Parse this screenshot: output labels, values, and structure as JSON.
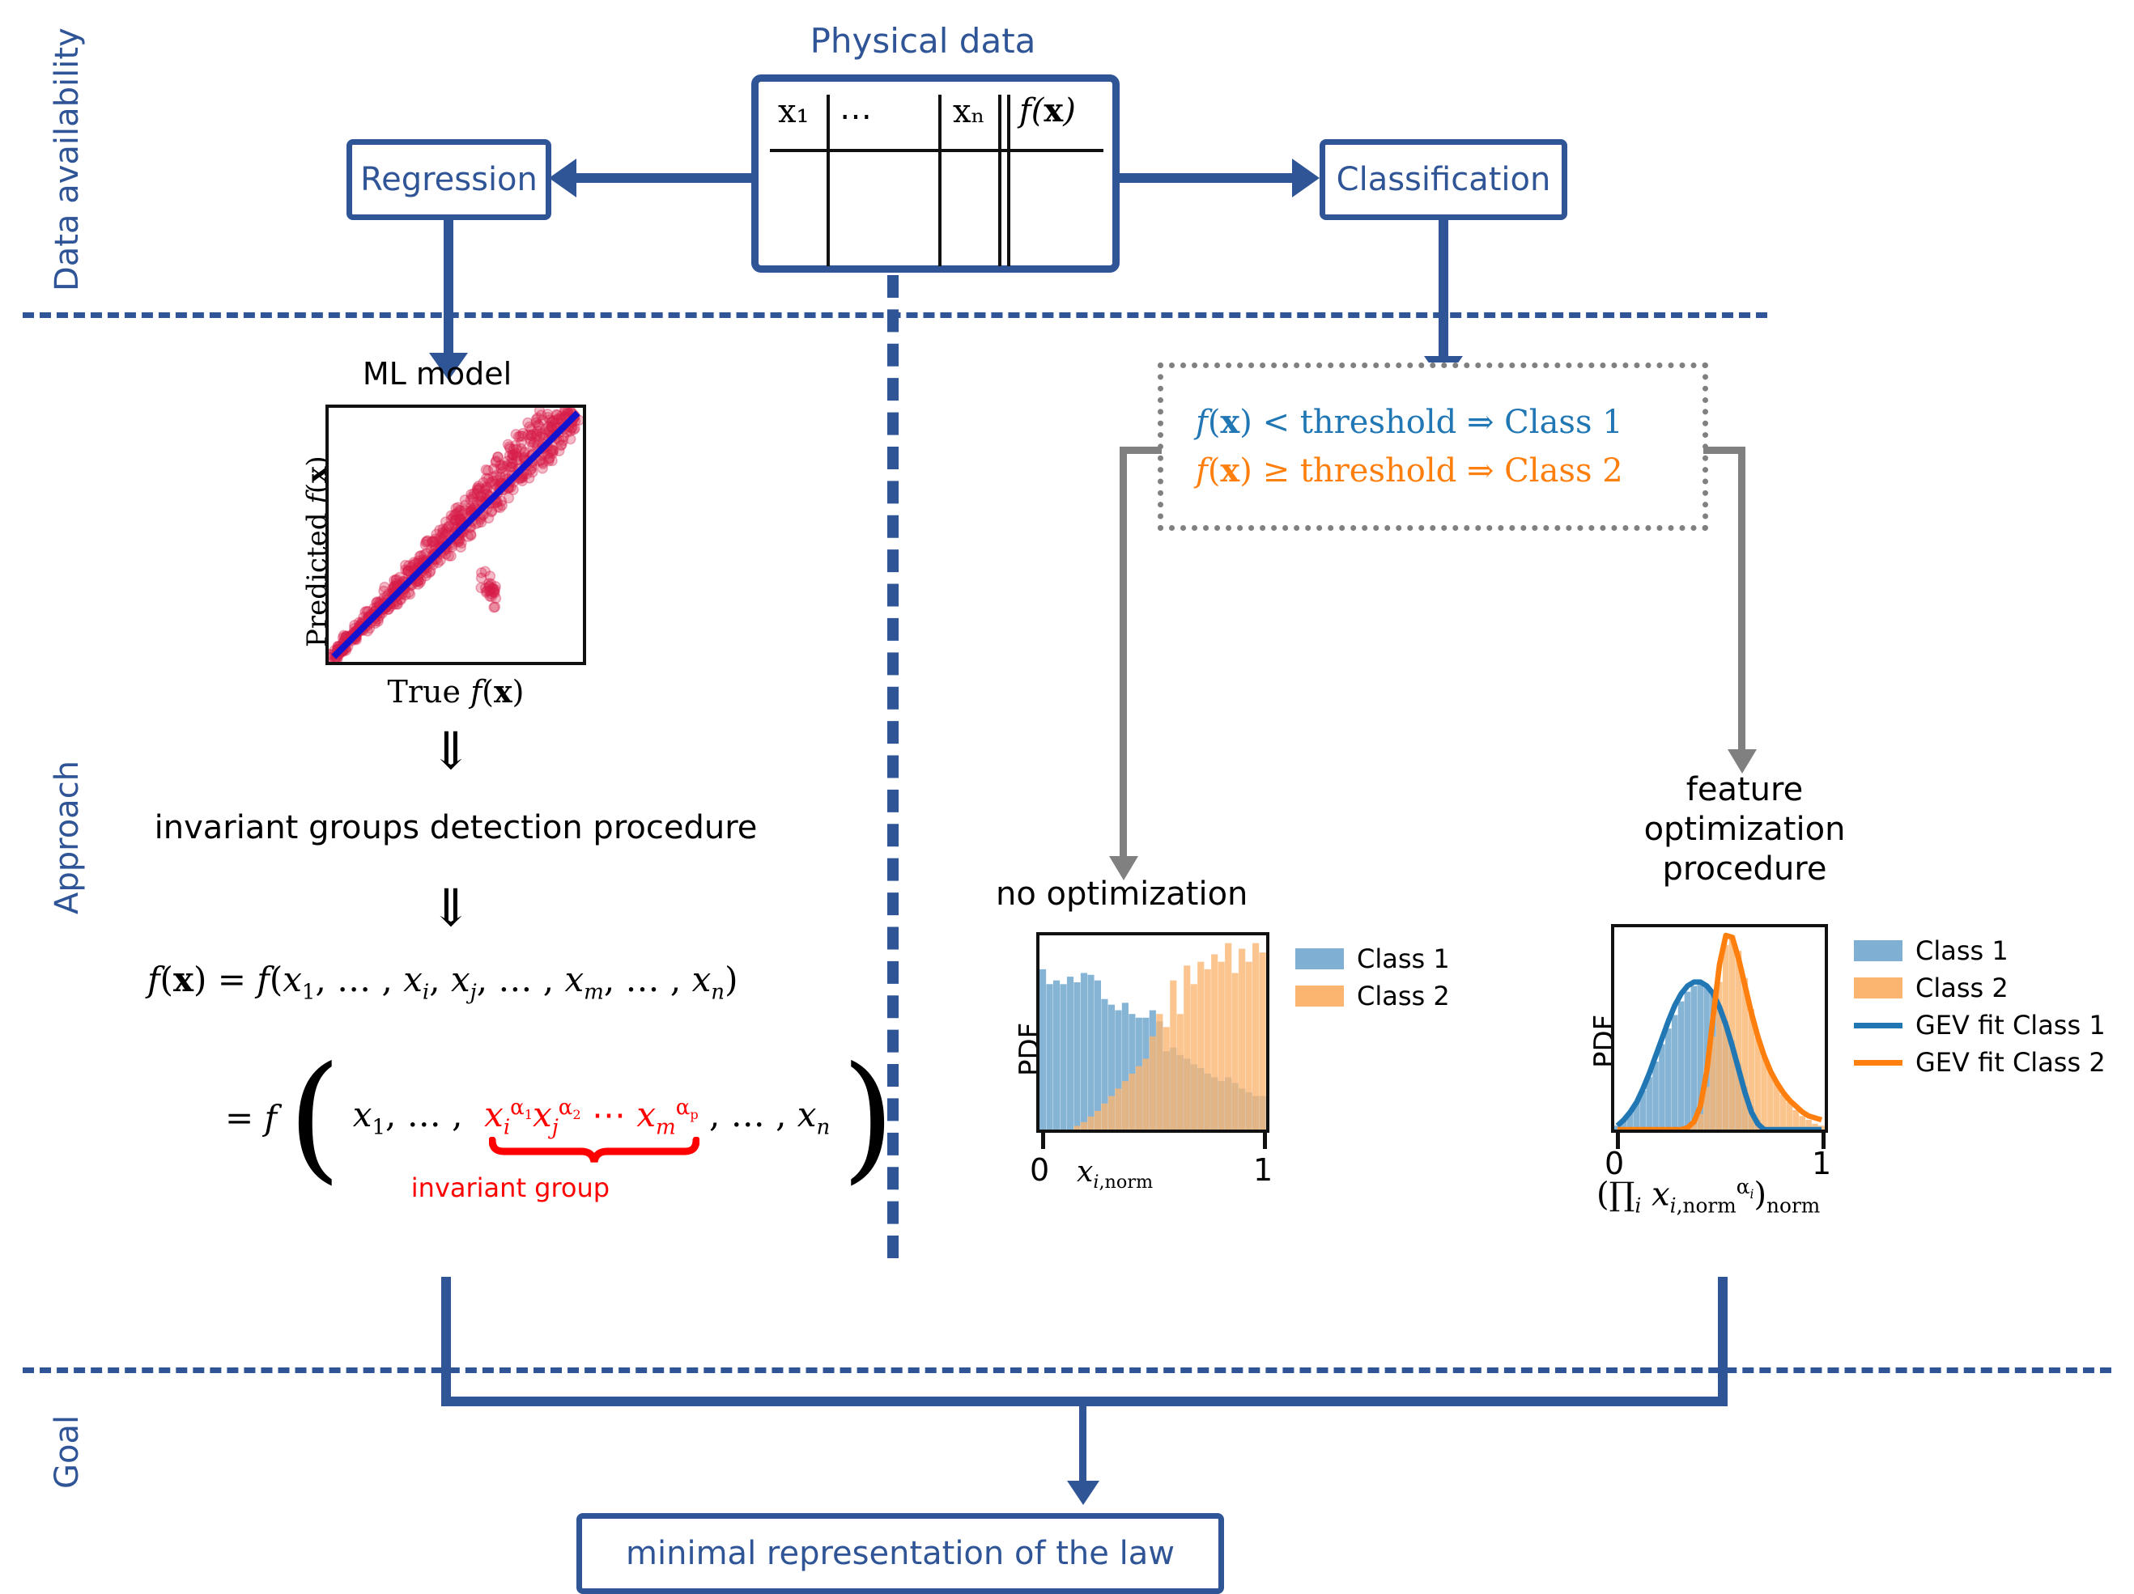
{
  "colors": {
    "brand_blue": "#2f5597",
    "gray_arrow": "#808080",
    "red": "#ff0000",
    "class1_fill": "#7fb0d3",
    "class2_fill": "#fbb570",
    "gev1_line": "#2077b4",
    "gev2_line": "#ff7f0e",
    "scatter_red": "#d81e4a",
    "fit_line_blue": "#1414ce"
  },
  "side_labels": [
    {
      "id": "data-availability",
      "text": "Data availability"
    },
    {
      "id": "approach",
      "text": "Approach"
    },
    {
      "id": "goal",
      "text": "Goal"
    }
  ],
  "data_table": {
    "title": "Physical data",
    "columns": [
      "x₁",
      "⋯",
      "xₙ",
      "f(x)"
    ]
  },
  "boxes": {
    "regression": "Regression",
    "classification": "Classification",
    "goal": "minimal representation of the law"
  },
  "threshold_rules": [
    {
      "id": "rule-class-1",
      "text": "f(x) < threshold ⇒ Class 1",
      "color": "#2077b4"
    },
    {
      "id": "rule-class-2",
      "text": "f(x) ≥ threshold ⇒ Class 2",
      "color": "#ff7f0e"
    }
  ],
  "ml_model": {
    "title": "ML model",
    "xlabel": "True f(x)",
    "ylabel": "Predicted f(x)"
  },
  "approach_text": {
    "procedure": "invariant groups detection procedure",
    "implies_symbol": "⇓",
    "equation_1": "f(x) = f(x₁, … , xᵢ, xⱼ, … , xₘ, … , xₙ)",
    "equation_2_prefix": "= f",
    "equation_2_left": "x₁, … ,",
    "equation_2_group": "xᵢ^α₁ xⱼ^α₂ ⋯ xₘ^αₚ",
    "equation_2_right": ", … , xₙ",
    "group_annotation": "invariant group"
  },
  "right_branch": {
    "no_opt_title": "no optimization",
    "feature_opt_title_lines": [
      "feature",
      "optimization",
      "procedure"
    ]
  },
  "chart_data": [
    {
      "id": "ml-model-scatter",
      "type": "scatter",
      "title": "ML model",
      "xlabel": "True f(x)",
      "ylabel": "Predicted f(x)",
      "xlim": [
        0,
        1
      ],
      "ylim": [
        0,
        1
      ],
      "grid": false,
      "ticks": {
        "x": [],
        "y": []
      },
      "series": [
        {
          "name": "predictions",
          "color": "#d81e4a",
          "marker": "circle",
          "alpha": 0.35,
          "description": "dense cloud of points hugging the 1:1 line, spread widening toward high values",
          "points": [
            [
              0.02,
              0.02
            ],
            [
              0.04,
              0.05
            ],
            [
              0.06,
              0.06
            ],
            [
              0.08,
              0.09
            ],
            [
              0.1,
              0.1
            ],
            [
              0.12,
              0.13
            ],
            [
              0.14,
              0.14
            ],
            [
              0.16,
              0.18
            ],
            [
              0.18,
              0.17
            ],
            [
              0.2,
              0.22
            ],
            [
              0.22,
              0.21
            ],
            [
              0.24,
              0.27
            ],
            [
              0.26,
              0.25
            ],
            [
              0.28,
              0.31
            ],
            [
              0.3,
              0.29
            ],
            [
              0.32,
              0.36
            ],
            [
              0.34,
              0.33
            ],
            [
              0.36,
              0.4
            ],
            [
              0.38,
              0.37
            ],
            [
              0.4,
              0.45
            ],
            [
              0.42,
              0.41
            ],
            [
              0.44,
              0.49
            ],
            [
              0.46,
              0.45
            ],
            [
              0.48,
              0.54
            ],
            [
              0.5,
              0.49
            ],
            [
              0.52,
              0.58
            ],
            [
              0.54,
              0.53
            ],
            [
              0.56,
              0.63
            ],
            [
              0.58,
              0.57
            ],
            [
              0.6,
              0.67
            ],
            [
              0.62,
              0.61
            ],
            [
              0.64,
              0.72
            ],
            [
              0.66,
              0.65
            ],
            [
              0.68,
              0.76
            ],
            [
              0.7,
              0.69
            ],
            [
              0.72,
              0.81
            ],
            [
              0.74,
              0.73
            ],
            [
              0.76,
              0.85
            ],
            [
              0.78,
              0.77
            ],
            [
              0.8,
              0.9
            ],
            [
              0.82,
              0.81
            ],
            [
              0.84,
              0.94
            ],
            [
              0.86,
              0.85
            ],
            [
              0.88,
              0.92
            ],
            [
              0.9,
              0.89
            ],
            [
              0.92,
              0.96
            ],
            [
              0.94,
              0.93
            ],
            [
              0.96,
              0.97
            ],
            [
              0.62,
              0.32
            ],
            [
              0.64,
              0.26
            ]
          ]
        },
        {
          "name": "ideal 1:1 line",
          "color": "#1414ce",
          "type": "line",
          "points": [
            [
              0.01,
              0.01
            ],
            [
              0.99,
              0.99
            ]
          ]
        }
      ]
    },
    {
      "id": "no-optimization-histogram",
      "type": "bar",
      "title": "no optimization",
      "xlabel": "x_{i,norm}",
      "ylabel": "PDF",
      "xlim": [
        0,
        1
      ],
      "xticks": [
        "0",
        "1"
      ],
      "grid": false,
      "legend_position": "right",
      "bin_centers": [
        0.02,
        0.05,
        0.08,
        0.11,
        0.14,
        0.17,
        0.2,
        0.23,
        0.26,
        0.29,
        0.32,
        0.35,
        0.38,
        0.41,
        0.44,
        0.47,
        0.5,
        0.53,
        0.56,
        0.59,
        0.62,
        0.65,
        0.68,
        0.71,
        0.74,
        0.77,
        0.8,
        0.83,
        0.86,
        0.89,
        0.92,
        0.95,
        0.98
      ],
      "series": [
        {
          "name": "Class 1",
          "color": "#7fb0d3",
          "values": [
            0.86,
            0.78,
            0.8,
            0.78,
            0.82,
            0.79,
            0.84,
            0.83,
            0.8,
            0.7,
            0.67,
            0.64,
            0.68,
            0.62,
            0.6,
            0.6,
            0.64,
            0.58,
            0.42,
            0.44,
            0.4,
            0.38,
            0.35,
            0.33,
            0.3,
            0.28,
            0.26,
            0.28,
            0.25,
            0.22,
            0.2,
            0.18,
            0.18
          ]
        },
        {
          "name": "Class 2",
          "color": "#fbb570",
          "values": [
            0.0,
            0.0,
            0.0,
            0.0,
            0.0,
            0.02,
            0.04,
            0.07,
            0.1,
            0.14,
            0.18,
            0.22,
            0.26,
            0.3,
            0.34,
            0.38,
            0.5,
            0.62,
            0.55,
            0.8,
            0.62,
            0.88,
            0.78,
            0.9,
            0.86,
            0.94,
            0.9,
            1.0,
            0.84,
            0.97,
            0.9,
            1.0,
            0.95
          ]
        }
      ]
    },
    {
      "id": "feature-optimization-histogram",
      "type": "bar",
      "title": "feature optimization procedure",
      "xlabel": "(∏_i x_{i,norm}^{α_i})_norm",
      "ylabel": "PDF",
      "xlim": [
        0,
        1
      ],
      "xticks": [
        "0",
        "1"
      ],
      "grid": false,
      "legend_position": "right",
      "bin_centers": [
        0.02,
        0.05,
        0.08,
        0.11,
        0.14,
        0.17,
        0.2,
        0.23,
        0.26,
        0.29,
        0.32,
        0.35,
        0.38,
        0.41,
        0.44,
        0.47,
        0.5,
        0.53,
        0.56,
        0.59,
        0.62,
        0.65,
        0.68,
        0.71,
        0.74,
        0.77,
        0.8,
        0.83,
        0.86,
        0.89,
        0.92,
        0.95,
        0.98
      ],
      "series": [
        {
          "name": "Class 1",
          "color": "#7fb0d3",
          "values": [
            0.02,
            0.05,
            0.09,
            0.14,
            0.2,
            0.27,
            0.35,
            0.44,
            0.52,
            0.59,
            0.66,
            0.71,
            0.74,
            0.75,
            0.74,
            0.7,
            0.64,
            0.56,
            0.46,
            0.34,
            0.22,
            0.12,
            0.05,
            0.01,
            0.0,
            0.0,
            0.0,
            0.0,
            0.0,
            0.0,
            0.0,
            0.0,
            0.0
          ]
        },
        {
          "name": "Class 2",
          "color": "#fbb570",
          "values": [
            0.0,
            0.0,
            0.0,
            0.0,
            0.0,
            0.0,
            0.0,
            0.0,
            0.0,
            0.0,
            0.0,
            0.01,
            0.03,
            0.08,
            0.22,
            0.48,
            0.76,
            0.95,
            1.0,
            0.92,
            0.78,
            0.62,
            0.48,
            0.38,
            0.3,
            0.24,
            0.18,
            0.14,
            0.1,
            0.07,
            0.05,
            0.03,
            0.02
          ]
        },
        {
          "name": "GEV fit Class 1",
          "type": "line",
          "color": "#2077b4",
          "values": [
            0.02,
            0.05,
            0.09,
            0.14,
            0.21,
            0.29,
            0.38,
            0.47,
            0.56,
            0.64,
            0.7,
            0.74,
            0.76,
            0.76,
            0.74,
            0.7,
            0.63,
            0.54,
            0.43,
            0.31,
            0.19,
            0.09,
            0.03,
            0.0,
            0.0,
            0.0,
            0.0,
            0.0,
            0.0,
            0.0,
            0.0,
            0.0,
            0.0
          ]
        },
        {
          "name": "GEV fit Class 2",
          "type": "line",
          "color": "#ff7f0e",
          "values": [
            0.0,
            0.0,
            0.0,
            0.0,
            0.0,
            0.0,
            0.0,
            0.0,
            0.0,
            0.0,
            0.0,
            0.01,
            0.04,
            0.12,
            0.3,
            0.58,
            0.85,
            1.0,
            0.99,
            0.88,
            0.74,
            0.6,
            0.48,
            0.38,
            0.3,
            0.24,
            0.19,
            0.15,
            0.12,
            0.09,
            0.07,
            0.06,
            0.05
          ]
        }
      ]
    }
  ],
  "legends": {
    "no_opt": [
      {
        "label": "Class 1",
        "kind": "swatch",
        "color": "#7fb0d3"
      },
      {
        "label": "Class 2",
        "kind": "swatch",
        "color": "#fbb570"
      }
    ],
    "feature_opt": [
      {
        "label": "Class 1",
        "kind": "swatch",
        "color": "#7fb0d3"
      },
      {
        "label": "Class 2",
        "kind": "swatch",
        "color": "#fbb570"
      },
      {
        "label": "GEV fit Class 1",
        "kind": "line",
        "color": "#2077b4"
      },
      {
        "label": "GEV fit Class 2",
        "kind": "line",
        "color": "#ff7f0e"
      }
    ]
  }
}
